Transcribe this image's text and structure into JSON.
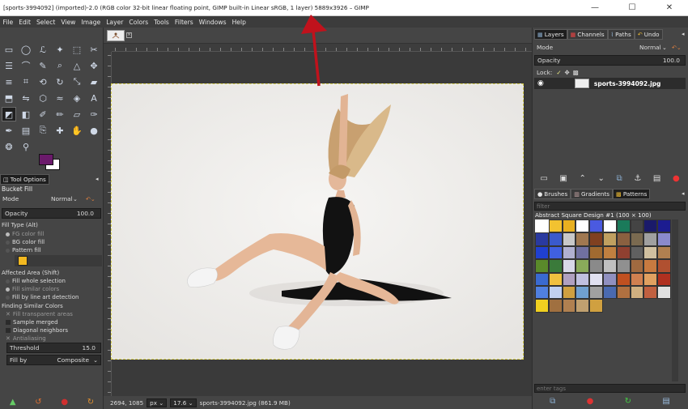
{
  "window": {
    "title": "[sports-3994092] (imported)-2.0 (RGB color 32-bit linear floating point, GIMP built-in Linear sRGB, 1 layer) 5889x3926 – GIMP",
    "minimize": "—",
    "maximize": "☐",
    "close": "✕"
  },
  "menu": [
    "File",
    "Edit",
    "Select",
    "View",
    "Image",
    "Layer",
    "Colors",
    "Tools",
    "Filters",
    "Windows",
    "Help"
  ],
  "tool_options": {
    "tab_label": "Tool Options",
    "tool_name": "Bucket Fill",
    "mode_label": "Mode",
    "mode_value": "Normal",
    "opacity_label": "Opacity",
    "opacity_value": "100.0",
    "fill_type_label": "Fill Type  (Alt)",
    "fill_type_options": [
      "FG color fill",
      "BG color fill",
      "Pattern fill"
    ],
    "affected_area_label": "Affected Area  (Shift)",
    "affected_area_options": [
      "Fill whole selection",
      "Fill similar colors",
      "Fill by line art detection"
    ],
    "finding_label": "Finding Similar Colors",
    "finding_options": [
      "Fill transparent areas",
      "Sample merged",
      "Diagonal neighbors",
      "Antialiasing"
    ],
    "threshold_label": "Threshold",
    "threshold_value": "15.0",
    "fill_by_label": "Fill by",
    "fill_by_value": "Composite"
  },
  "status": {
    "coords": "2694, 1085",
    "unit": "px",
    "zoom": "17.6",
    "file": "sports-3994092.jpg (861.9 MB)"
  },
  "layers_panel": {
    "tabs": [
      "Layers",
      "Channels",
      "Paths",
      "Undo"
    ],
    "mode_label": "Mode",
    "mode_value": "Normal",
    "opacity_label": "Opacity",
    "opacity_value": "100.0",
    "lock_label": "Lock:",
    "layer_name": "sports-3994092.jpg"
  },
  "brushes_panel": {
    "tabs": [
      "Brushes",
      "Gradients",
      "Patterns"
    ],
    "filter_placeholder": "filter",
    "pattern_name": "Abstract Square Design #1 (100 × 100)",
    "tags_placeholder": "enter tags"
  },
  "colors": {
    "fg": "#6b1a6b",
    "bg": "#ffffff",
    "accent_arrow": "#c0121c",
    "canvas_bg": "#eeedeb"
  },
  "patterns": [
    "#ffffff",
    "#f2c230",
    "#e8b020",
    "#ffffff",
    "#4a5ae0",
    "#ffffff",
    "#1a7a5a",
    "#444444",
    "#1a1a6a",
    "#1c1c90",
    "#2a3aa0",
    "#3a5acc",
    "#c8c8c8",
    "#a07850",
    "#804020",
    "#c0a060",
    "#8a6040",
    "#7a6a50",
    "#a0a0a0",
    "#8a8acc",
    "#2040d0",
    "#4060e0",
    "#b0b0d0",
    "#7070a0",
    "#a06a30",
    "#c08040",
    "#904030",
    "#606060",
    "#d0c0a0",
    "#b08050",
    "#5a8a2a",
    "#3a7a3a",
    "#d8d8e8",
    "#8aaa5a",
    "#8a8a8a",
    "#c0c0c0",
    "#909090",
    "#a06a40",
    "#c87a40",
    "#b05030",
    "#3a6ad0",
    "#f0c040",
    "#b0a0c0",
    "#c0c0e0",
    "#e0e0f0",
    "#9090c0",
    "#c05020",
    "#d08050",
    "#e0a060",
    "#b03020",
    "#5080e0",
    "#c0d0f0",
    "#d0a040",
    "#70a0d0",
    "#a0a0a0",
    "#4a6ab0",
    "#b07040",
    "#d0b080",
    "#c06040",
    "#e0e0e0",
    "#f0d020",
    "#a07040",
    "#b08050",
    "#c0a070",
    "#d0a040"
  ],
  "icons": {
    "eye": "eye-icon",
    "chain": "chain-icon",
    "anchor": "anchor-icon"
  }
}
